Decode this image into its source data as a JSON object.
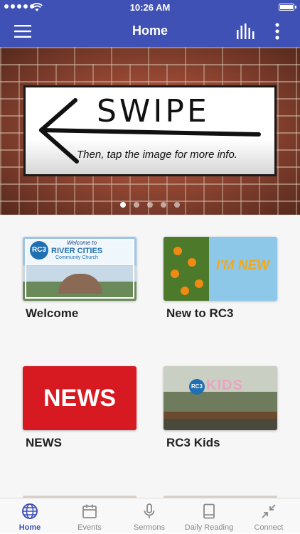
{
  "status_bar": {
    "time": "10:26 AM"
  },
  "app_bar": {
    "title": "Home"
  },
  "hero": {
    "sign_word": "SWIPE",
    "sign_subtitle": "Then, tap the image for more info.",
    "slide_count": 5,
    "active_slide": 1
  },
  "tiles": [
    {
      "label": "Welcome",
      "image": {
        "line1": "Welcome to",
        "line2": "RIVER CITIES",
        "line3": "Community Church",
        "logo": "RC3"
      }
    },
    {
      "label": "New to RC3",
      "image": {
        "text": "I'M NEW"
      }
    },
    {
      "label": "NEWS",
      "image": {
        "text": "NEWS"
      }
    },
    {
      "label": "RC3 Kids",
      "image": {
        "logo": "RC3",
        "text": "KIDS"
      }
    }
  ],
  "tab_bar": {
    "tabs": [
      {
        "label": "Home",
        "icon": "globe-icon",
        "active": true
      },
      {
        "label": "Events",
        "icon": "calendar-icon",
        "active": false
      },
      {
        "label": "Sermons",
        "icon": "microphone-icon",
        "active": false
      },
      {
        "label": "Daily Reading",
        "icon": "book-icon",
        "active": false
      },
      {
        "label": "Connect",
        "icon": "connect-icon",
        "active": false
      }
    ]
  },
  "colors": {
    "primary": "#3f51b5",
    "news_red": "#d71921",
    "tab_inactive": "#8a8a8a"
  }
}
